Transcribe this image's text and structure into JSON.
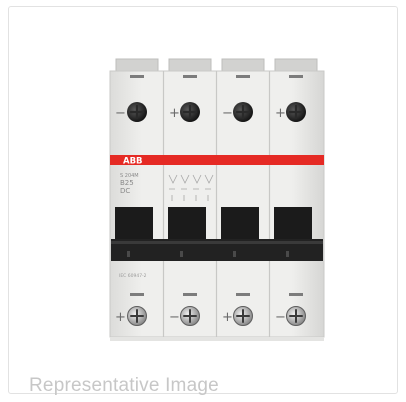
{
  "caption": "Representative Image",
  "product": {
    "brand": "ABB",
    "rating": "B25",
    "voltage": "DC",
    "pole_signs_top": [
      "−",
      "+",
      "−",
      "+"
    ],
    "pole_signs_bottom": [
      "+",
      "−",
      "+",
      "−"
    ],
    "poles": 4
  },
  "colors": {
    "brand_band": "#e52a24",
    "housing": "#e9e9e7",
    "toggle": "#1b1b1b",
    "caption": "#c7c7c7"
  }
}
